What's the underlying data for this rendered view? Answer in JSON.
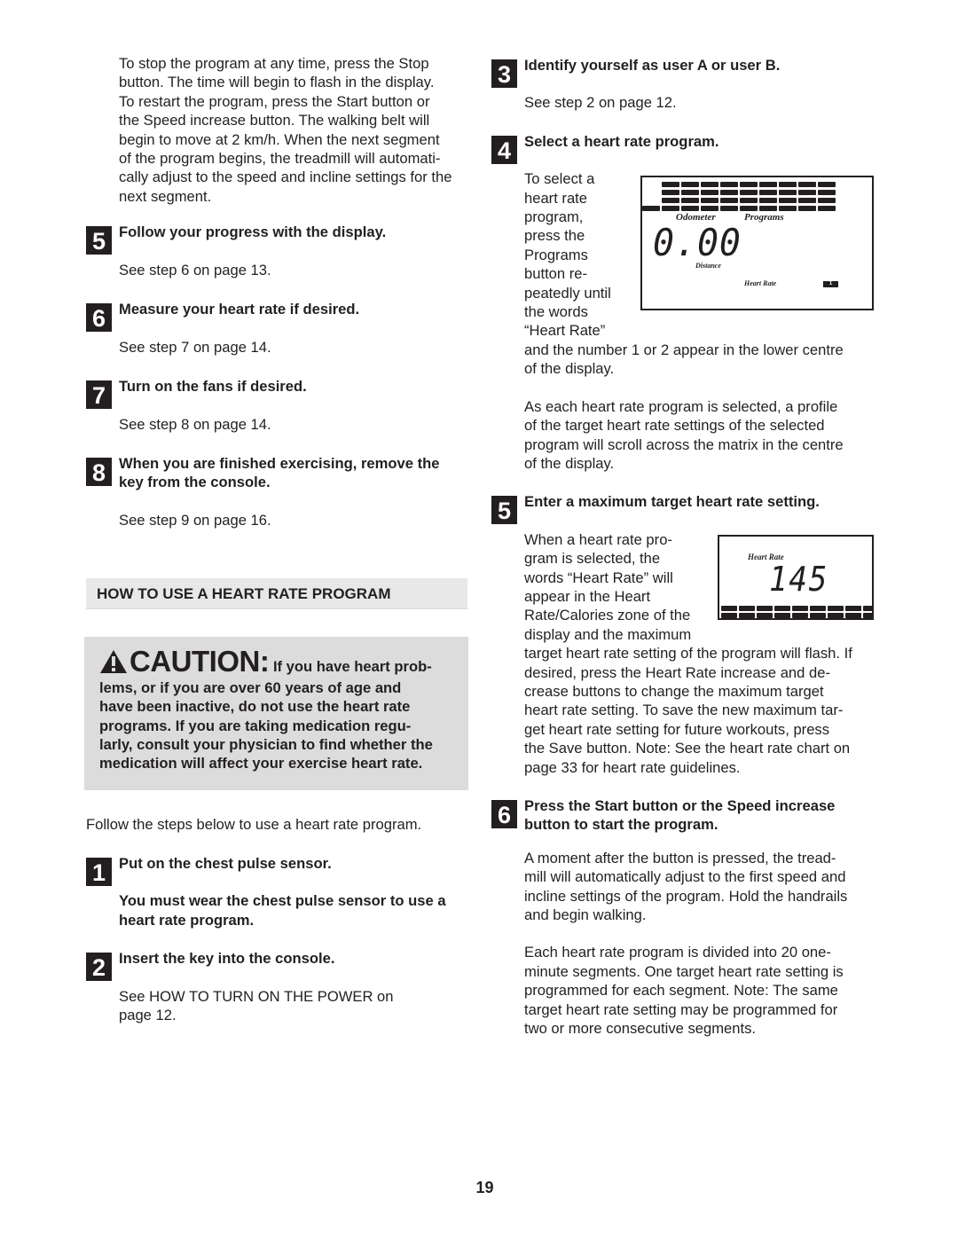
{
  "page": {
    "number": "19"
  },
  "left_column": {
    "intro_paragraph": "To stop the program at any time, press the Stop button. The time will begin to flash in the display. To restart the program, press the Start button or the Speed increase button. The walking belt will begin to move at 2 km/h. When the next segment of the program begins, the treadmill will automatically adjust to the speed and incline settings for the next segment.",
    "intro_lines": [
      "To stop the program at any time, press the Stop",
      "button. The time will begin to flash in the display.",
      "To restart the program, press the Start button or",
      "the Speed increase button. The walking belt will",
      "begin to move at 2 km/h. When the next segment",
      "of the program begins, the treadmill will automati-",
      "cally adjust to the speed and incline settings for the",
      "next segment."
    ],
    "steps_prev": [
      {
        "number": "5",
        "title": "Follow your progress with the display.",
        "body": "See step 6 on page 13."
      },
      {
        "number": "6",
        "title": "Measure your heart rate if desired.",
        "body": "See step 7 on page 14."
      },
      {
        "number": "7",
        "title": "Turn on the fans if desired.",
        "body": "See step 8 on page 14."
      },
      {
        "number": "8",
        "title_lines": [
          "When you are finished exercising, remove the",
          "key from the console."
        ],
        "body": "See step 9 on page 16."
      }
    ],
    "section_header": "HOW TO USE A HEART RATE PROGRAM",
    "caution": {
      "icon": "warning-triangle-icon",
      "heading": "CAUTION:",
      "first_line": "If you have heart prob-",
      "lines": [
        "lems, or if you are over 60 years of age and",
        "have been inactive, do not use the heart rate",
        "programs. If you are taking medication regu-",
        "larly, consult your physician to find whether the",
        "medication will affect your exercise heart rate."
      ]
    },
    "follow_text": "Follow the steps below to use a heart rate program.",
    "steps_hr": [
      {
        "number": "1",
        "title": "Put on the chest pulse sensor.",
        "note_lines": [
          "You must wear the chest pulse sensor to use a",
          "heart rate program."
        ]
      },
      {
        "number": "2",
        "title": "Insert the key into the console.",
        "body_lines": [
          "See HOW TO TURN ON THE POWER on",
          "page 12."
        ]
      }
    ]
  },
  "right_column": {
    "step3": {
      "number": "3",
      "title": "Identify yourself as user A or user B.",
      "body": "See step 2 on page 12."
    },
    "step4": {
      "number": "4",
      "title": "Select a heart rate program.",
      "narrow_lines": [
        "To select a",
        "heart rate",
        "program,",
        "press the",
        "Programs",
        "button re-",
        "peatedly until",
        "the words",
        "“Heart Rate”"
      ],
      "wide_lines": [
        "and the number 1 or 2 appear in the lower centre",
        "of the display."
      ],
      "para2_lines": [
        "As each heart rate program is selected, a profile",
        "of the target heart rate settings of the selected",
        "program will scroll across the matrix in the centre",
        "of the display."
      ],
      "display": {
        "odometer_label": "Odometer",
        "programs_label": "Programs",
        "distance_value": "0.00",
        "distance_label": "Distance",
        "heart_rate_label": "Heart Rate",
        "program_number": "1",
        "matrix_levels": [
          1,
          4,
          4,
          4,
          4,
          4,
          4,
          4,
          4,
          4
        ],
        "matrix_max_level": 4
      }
    },
    "step5": {
      "number": "5",
      "title": "Enter a maximum target heart rate setting.",
      "narrow_lines": [
        "When a heart rate pro-",
        "gram is selected, the",
        "words “Heart Rate” will",
        "appear in the Heart",
        "Rate/Calories zone of the",
        "display and the maximum"
      ],
      "wide_lines": [
        "target heart rate setting of the program will flash. If",
        "desired, press the Heart Rate increase and de-",
        "crease buttons to change the maximum target",
        "heart rate setting. To save the new maximum tar-",
        "get heart rate setting for future workouts, press",
        "the Save button. Note: See the heart rate chart on",
        "page 33 for heart rate guidelines."
      ],
      "display": {
        "heart_rate_label": "Heart Rate",
        "heart_rate_value": "145",
        "matrix_columns": 10,
        "matrix_rows": 2
      }
    },
    "step6": {
      "number": "6",
      "title_lines": [
        "Press the Start button or the Speed increase",
        "button to start the program."
      ],
      "para1_lines": [
        "A moment after the button is pressed, the tread-",
        "mill will automatically adjust to the first speed and",
        "incline settings of the program. Hold the handrails",
        "and begin walking."
      ],
      "para2_lines": [
        "Each heart rate program is divided into 20 one-",
        "minute segments. One target heart rate setting is",
        "programmed for each segment. Note: The same",
        "target heart rate setting may be programmed for",
        "two or more consecutive segments."
      ]
    }
  }
}
